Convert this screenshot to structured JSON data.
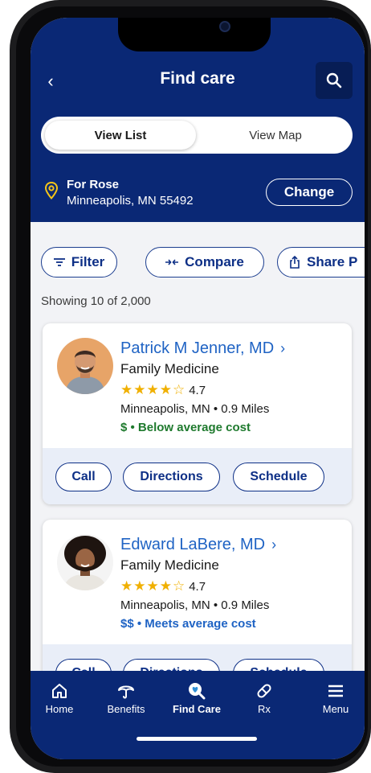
{
  "header": {
    "title": "Find care",
    "back_icon": "chevron-left-icon",
    "search_icon": "search-icon"
  },
  "view_toggle": {
    "options": [
      "View List",
      "View Map"
    ],
    "selected": "View List"
  },
  "location": {
    "name": "For Rose",
    "address": "Minneapolis, MN 55492",
    "change_label": "Change"
  },
  "chips": [
    {
      "label": "Filter",
      "icon": "filter-icon"
    },
    {
      "label": "Compare",
      "icon": "compare-icon"
    },
    {
      "label": "Share P",
      "icon": "share-icon"
    }
  ],
  "results": {
    "showing_text": "Showing 10 of 2,000"
  },
  "providers": [
    {
      "name": "Patrick M Jenner, MD",
      "specialty": "Family Medicine",
      "stars": "★★★★☆",
      "rating": "4.7",
      "location": "Minneapolis, MN • 0.9 Miles",
      "cost": "$ • Below average cost",
      "cost_color": "#1f7a2e",
      "actions": [
        "Call",
        "Directions",
        "Schedule"
      ]
    },
    {
      "name": "Edward LaBere, MD",
      "specialty": "Family Medicine",
      "stars": "★★★★☆",
      "rating": "4.7",
      "location": "Minneapolis, MN • 0.9 Miles",
      "cost": "$$ • Meets average cost",
      "cost_color": "#1f63c4",
      "actions": [
        "Call",
        "Directions",
        "Schedule"
      ]
    }
  ],
  "tabbar": {
    "items": [
      {
        "label": "Home",
        "icon": "home-icon"
      },
      {
        "label": "Benefits",
        "icon": "umbrella-icon"
      },
      {
        "label": "Find Care",
        "icon": "find-care-icon",
        "active": true
      },
      {
        "label": "Rx",
        "icon": "pill-icon"
      },
      {
        "label": "Menu",
        "icon": "menu-icon"
      }
    ]
  },
  "colors": {
    "brand_navy": "#0a2875",
    "link_blue": "#1f63c4",
    "star_gold": "#f0b000",
    "location_pin": "#f5c518"
  }
}
